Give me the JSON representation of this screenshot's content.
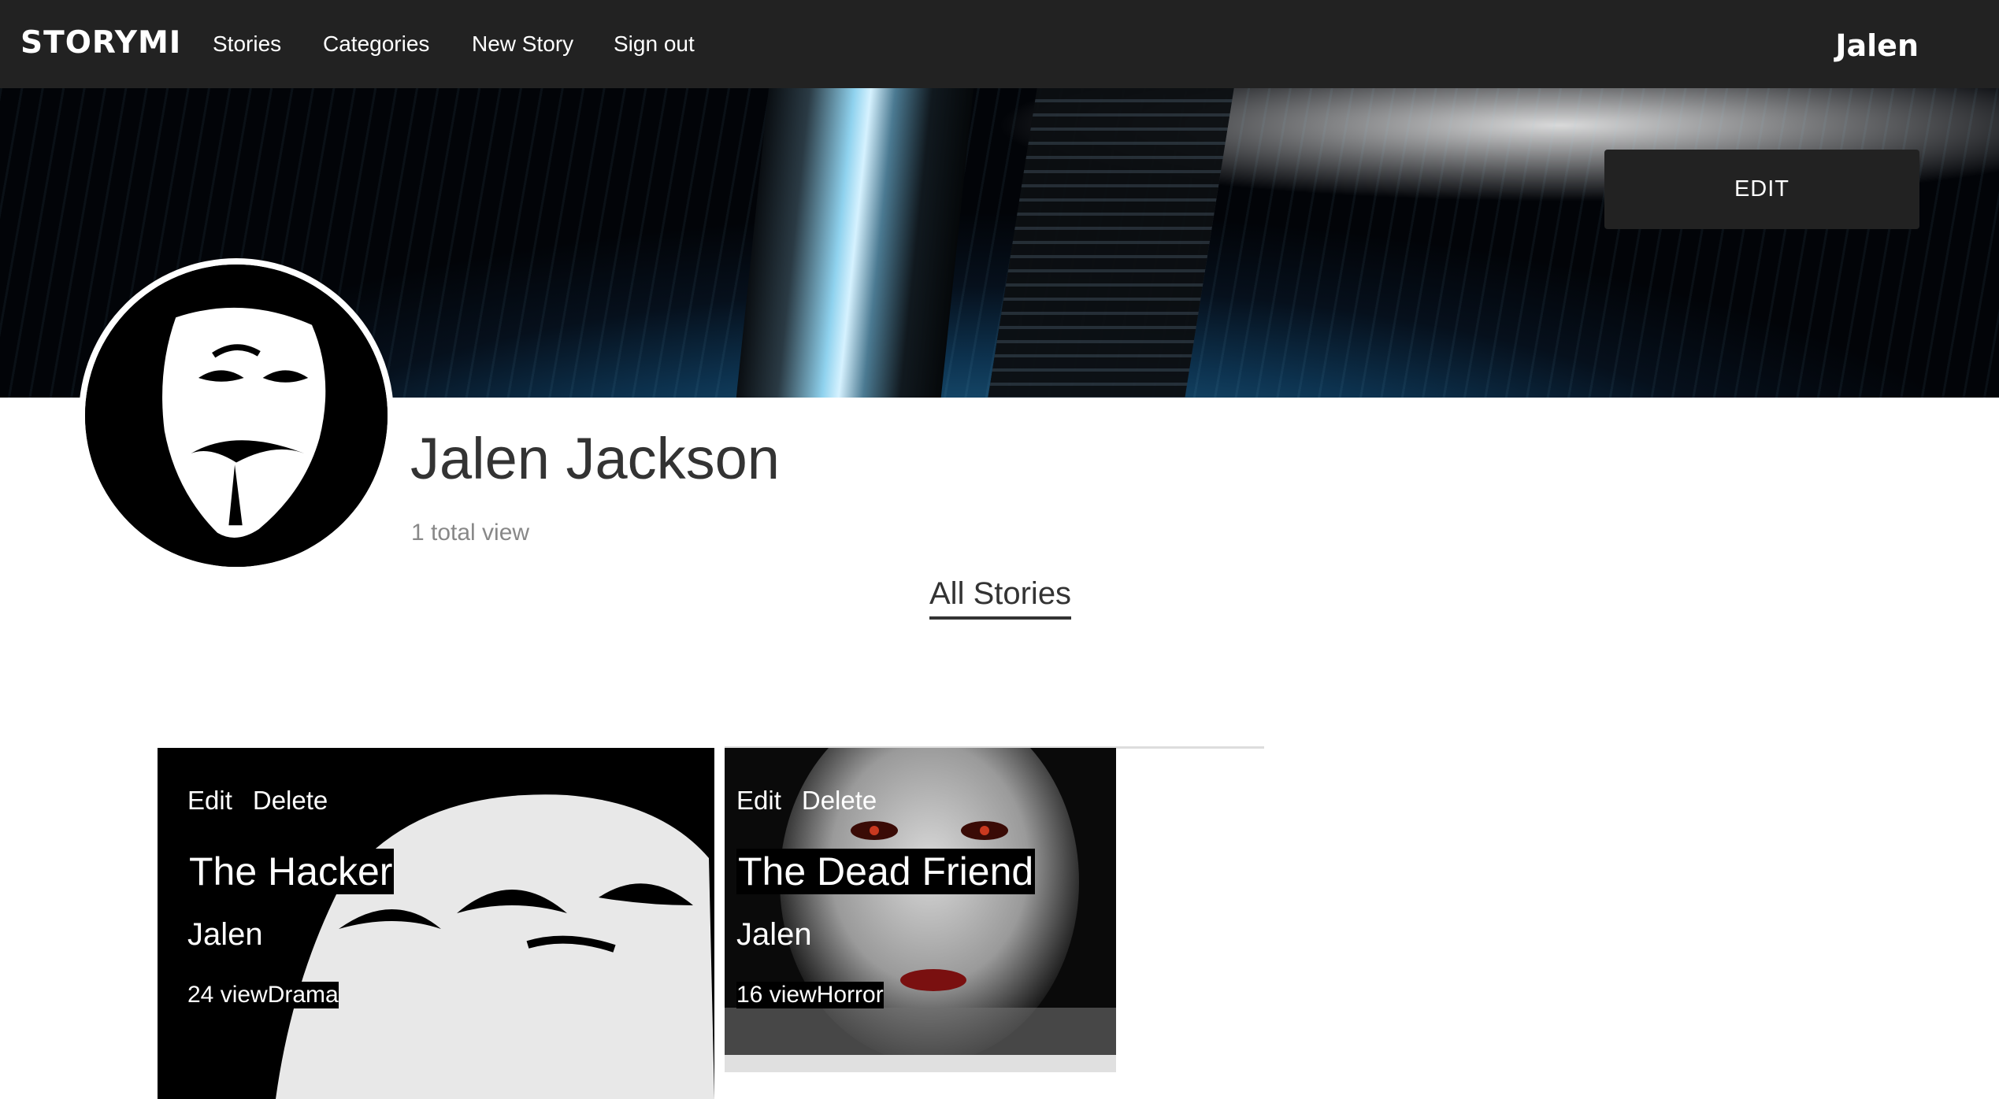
{
  "nav": {
    "logo": "STORYMI",
    "links": [
      "Stories",
      "Categories",
      "New Story",
      "Sign out"
    ],
    "user": "Jalen"
  },
  "profile": {
    "edit_label": "EDIT",
    "name": "Jalen Jackson",
    "total_views": "1 total view",
    "avatar_icon": "guy-fawkes-mask-icon"
  },
  "tabs": {
    "all_stories": "All Stories"
  },
  "stories": [
    {
      "edit_label": "Edit",
      "delete_label": "Delete",
      "title": "The Hacker",
      "author": "Jalen",
      "views": "24 view",
      "category": "Drama",
      "image": "guy-fawkes-mask-image"
    },
    {
      "edit_label": "Edit",
      "delete_label": "Delete",
      "title": "The Dead Friend",
      "author": "Jalen",
      "views": "16 view",
      "category": "Horror",
      "image": "pale-face-red-eyes-image"
    }
  ],
  "colors": {
    "nav_bg": "#222222",
    "button_bg": "#222222",
    "text": "#333333",
    "muted": "#888888"
  }
}
